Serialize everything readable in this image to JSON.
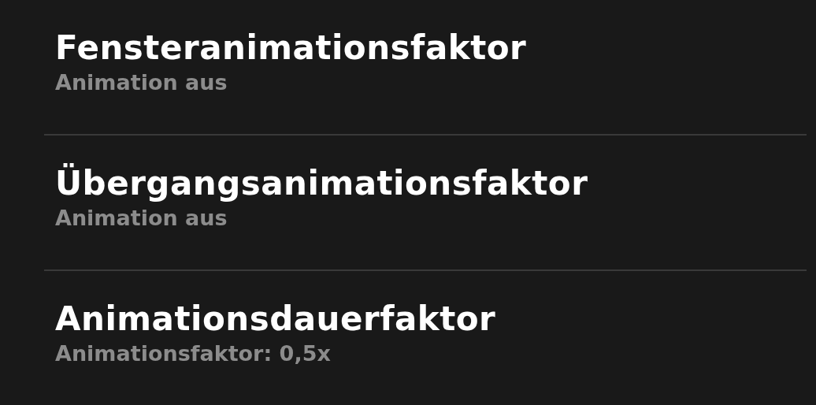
{
  "settings": [
    {
      "title": "Fensteranimationsfaktor",
      "summary": "Animation aus"
    },
    {
      "title": "Übergangsanimationsfaktor",
      "summary": "Animation aus"
    },
    {
      "title": "Animationsdauerfaktor",
      "summary": "Animationsfaktor: 0,5x"
    }
  ]
}
